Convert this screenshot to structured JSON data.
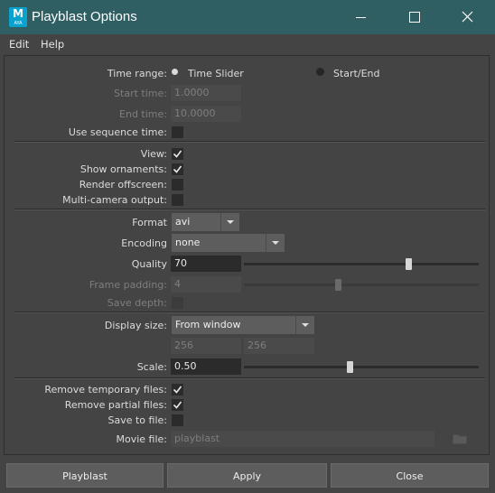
{
  "window": {
    "title": "Playblast Options",
    "app_icon_letter": "M",
    "app_icon_sub": "AYA",
    "controls": [
      "minimize-icon",
      "maximize-icon",
      "close-icon"
    ],
    "titlebar_color": "#2f5f62"
  },
  "menubar": {
    "items": [
      "Edit",
      "Help"
    ]
  },
  "time_range": {
    "label": "Time range:",
    "options": [
      "Time Slider",
      "Start/End"
    ],
    "selected": "Time Slider",
    "start_label": "Start time:",
    "start_value": "1.0000",
    "end_label": "End time:",
    "end_value": "10.0000",
    "use_sequence_label": "Use sequence time:",
    "use_sequence_checked": false
  },
  "display": {
    "view_label": "View:",
    "view_checked": true,
    "ornaments_label": "Show ornaments:",
    "ornaments_checked": true,
    "offscreen_label": "Render offscreen:",
    "offscreen_checked": false,
    "multicam_label": "Multi-camera output:",
    "multicam_checked": false
  },
  "encoding": {
    "format_label": "Format",
    "format_value": "avi",
    "encoding_label": "Encoding",
    "encoding_value": "none",
    "quality_label": "Quality",
    "quality_value": "70",
    "quality_slider_pct": 70,
    "frame_padding_label": "Frame padding:",
    "frame_padding_value": "4",
    "frame_padding_slider_pct": 40,
    "save_depth_label": "Save depth:",
    "save_depth_checked": false
  },
  "size": {
    "display_size_label": "Display size:",
    "display_size_value": "From window",
    "width_value": "256",
    "height_value": "256",
    "scale_label": "Scale:",
    "scale_value": "0.50",
    "scale_slider_pct": 45
  },
  "files": {
    "remove_temp_label": "Remove temporary files:",
    "remove_temp_checked": true,
    "remove_partial_label": "Remove partial files:",
    "remove_partial_checked": true,
    "save_to_file_label": "Save to file:",
    "save_to_file_checked": false,
    "movie_file_label": "Movie file:",
    "movie_file_value": "playblast",
    "browse_icon": "folder-icon"
  },
  "buttons": {
    "playblast": "Playblast",
    "apply": "Apply",
    "close": "Close"
  }
}
